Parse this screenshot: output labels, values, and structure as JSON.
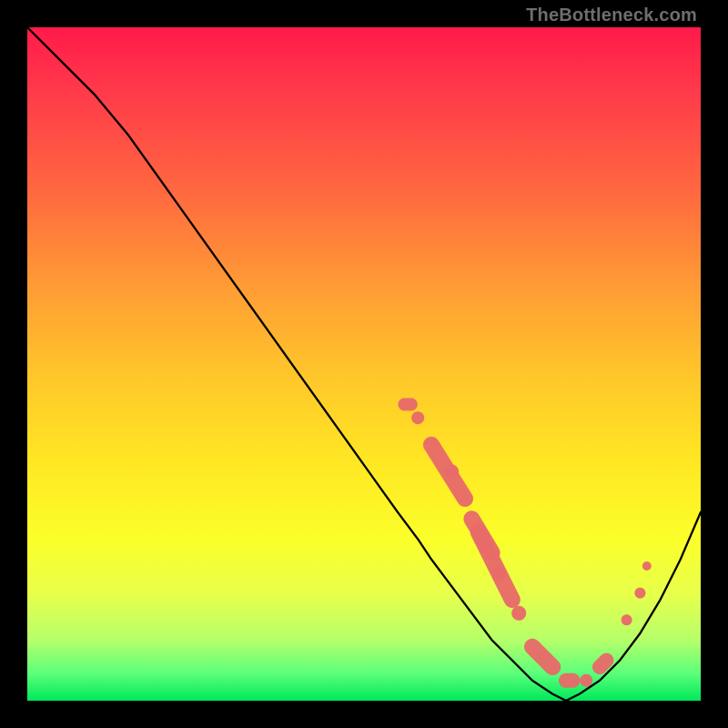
{
  "watermark": "TheBottleneck.com",
  "chart_data": {
    "type": "line",
    "title": "",
    "xlabel": "",
    "ylabel": "",
    "xlim": [
      0,
      100
    ],
    "ylim": [
      0,
      100
    ],
    "grid": false,
    "legend": false,
    "background_gradient": [
      "#ff1a4a",
      "#ffe823",
      "#00e85a"
    ],
    "series": [
      {
        "name": "curve",
        "x": [
          0,
          5,
          10,
          15,
          20,
          25,
          30,
          35,
          40,
          45,
          50,
          55,
          58,
          60,
          63,
          66,
          69,
          72,
          75,
          78,
          80,
          82,
          85,
          88,
          91,
          94,
          97,
          100
        ],
        "y": [
          100,
          95,
          90,
          84,
          77,
          70,
          63,
          56,
          49,
          42,
          35,
          28,
          24,
          21,
          17,
          13,
          9,
          6,
          3,
          1,
          0,
          1,
          3,
          6,
          10,
          15,
          21,
          28
        ]
      }
    ],
    "markers": {
      "color": "#e86a6a",
      "segments": [
        {
          "x0": 56,
          "y0": 56,
          "x1": 57,
          "y1": 56,
          "r": 7
        },
        {
          "x0": 58,
          "y0": 58,
          "x1": 58,
          "y1": 58,
          "r": 7
        },
        {
          "x0": 60,
          "y0": 62,
          "x1": 65,
          "y1": 70,
          "r": 9
        },
        {
          "x0": 63,
          "y0": 66,
          "x1": 63,
          "y1": 66,
          "r": 8
        },
        {
          "x0": 66,
          "y0": 73,
          "x1": 69,
          "y1": 78,
          "r": 9
        },
        {
          "x0": 67,
          "y0": 75,
          "x1": 72,
          "y1": 85,
          "r": 9
        },
        {
          "x0": 70,
          "y0": 81,
          "x1": 70,
          "y1": 81,
          "r": 8
        },
        {
          "x0": 73,
          "y0": 87,
          "x1": 73,
          "y1": 87,
          "r": 8
        },
        {
          "x0": 75,
          "y0": 92,
          "x1": 78,
          "y1": 95,
          "r": 9
        },
        {
          "x0": 80,
          "y0": 97,
          "x1": 81,
          "y1": 97,
          "r": 8
        },
        {
          "x0": 83,
          "y0": 97,
          "x1": 83,
          "y1": 97,
          "r": 7
        },
        {
          "x0": 85,
          "y0": 95,
          "x1": 86,
          "y1": 94,
          "r": 8
        },
        {
          "x0": 89,
          "y0": 88,
          "x1": 89,
          "y1": 88,
          "r": 6
        },
        {
          "x0": 91,
          "y0": 84,
          "x1": 91,
          "y1": 84,
          "r": 6
        },
        {
          "x0": 92,
          "y0": 80,
          "x1": 92,
          "y1": 80,
          "r": 5
        }
      ]
    }
  }
}
